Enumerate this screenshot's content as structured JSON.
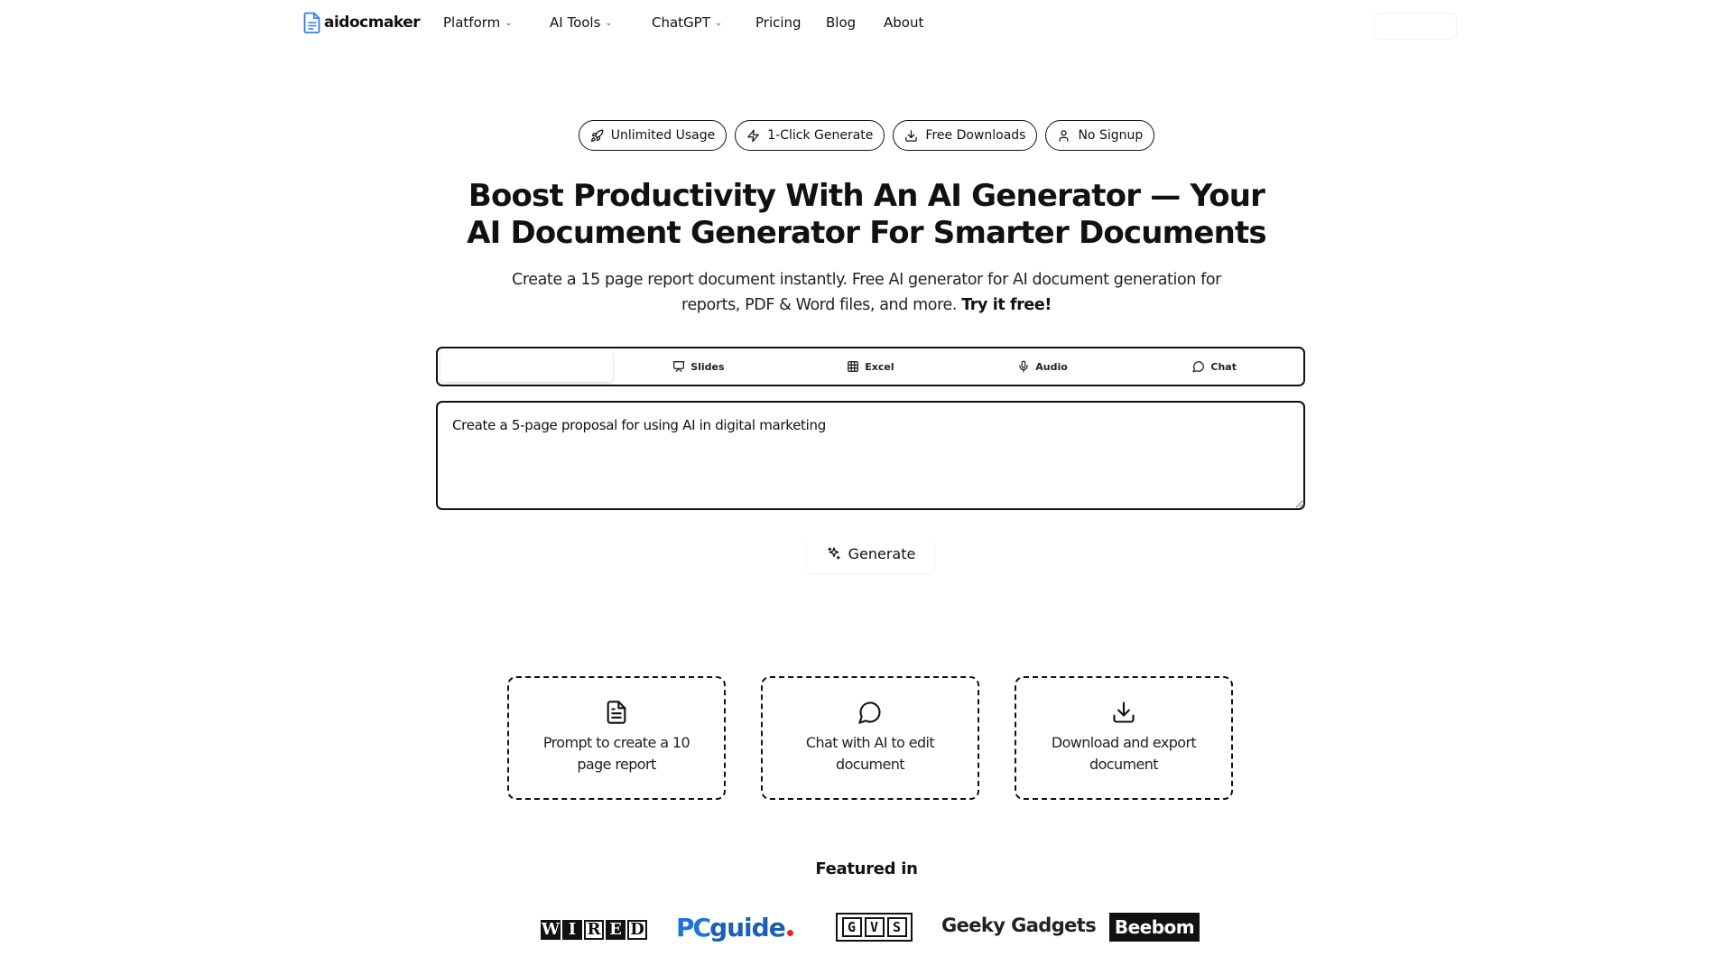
{
  "nav": {
    "brand": "aidocmaker",
    "items": [
      {
        "label": "Platform",
        "dropdown": true
      },
      {
        "label": "AI Tools",
        "dropdown": true
      },
      {
        "label": "ChatGPT",
        "dropdown": true
      },
      {
        "label": "Pricing",
        "dropdown": false
      },
      {
        "label": "Blog",
        "dropdown": false
      },
      {
        "label": "About",
        "dropdown": false
      }
    ]
  },
  "badges": [
    {
      "label": "Unlimited Usage",
      "icon": "rocket-icon"
    },
    {
      "label": "1-Click Generate",
      "icon": "lightning-icon"
    },
    {
      "label": "Free Downloads",
      "icon": "download-icon"
    },
    {
      "label": "No Signup",
      "icon": "user-icon"
    }
  ],
  "hero": {
    "title_line1": "Boost Productivity With An AI Generator — Your",
    "title_line2": "AI Document Generator For Smarter Documents",
    "subtitle_line1": "Create a 15 page report document instantly. Free AI generator for AI document generation for",
    "subtitle_line2": "reports, PDF & Word files, and more.",
    "subtitle_cta": "Try it free!"
  },
  "tabs": [
    {
      "label": "",
      "icon": "",
      "active": true
    },
    {
      "label": "Slides",
      "icon": "presentation-icon",
      "active": false
    },
    {
      "label": "Excel",
      "icon": "table-icon",
      "active": false
    },
    {
      "label": "Audio",
      "icon": "microphone-icon",
      "active": false
    },
    {
      "label": "Chat",
      "icon": "chat-bubble-icon",
      "active": false
    }
  ],
  "prompt": {
    "value": "Create a 5-page proposal for using AI in digital marketing"
  },
  "generate": {
    "label": "Generate",
    "icon": "sparkle-icon"
  },
  "features": [
    {
      "label": "Prompt to create a 10 page report",
      "icon": "document-icon"
    },
    {
      "label": "Chat with AI to edit document",
      "icon": "chat-bubble-icon"
    },
    {
      "label": "Download and export document",
      "icon": "download-icon"
    }
  ],
  "featured": {
    "title": "Featured in",
    "logos": {
      "wired": [
        "W",
        "I",
        "R",
        "E",
        "D"
      ],
      "pcguide_pc": "PC",
      "pcguide_guide": "guide",
      "gvs": [
        "G",
        "V",
        "S"
      ],
      "geeky": "Geeky Gadgets",
      "beebom": "Beebom"
    }
  },
  "colors": {
    "text": "#111111",
    "brand_doc_icon": "#2f80ed",
    "pcguide_blue": "#1e73d8",
    "pcguide_dot": "#e32626"
  }
}
